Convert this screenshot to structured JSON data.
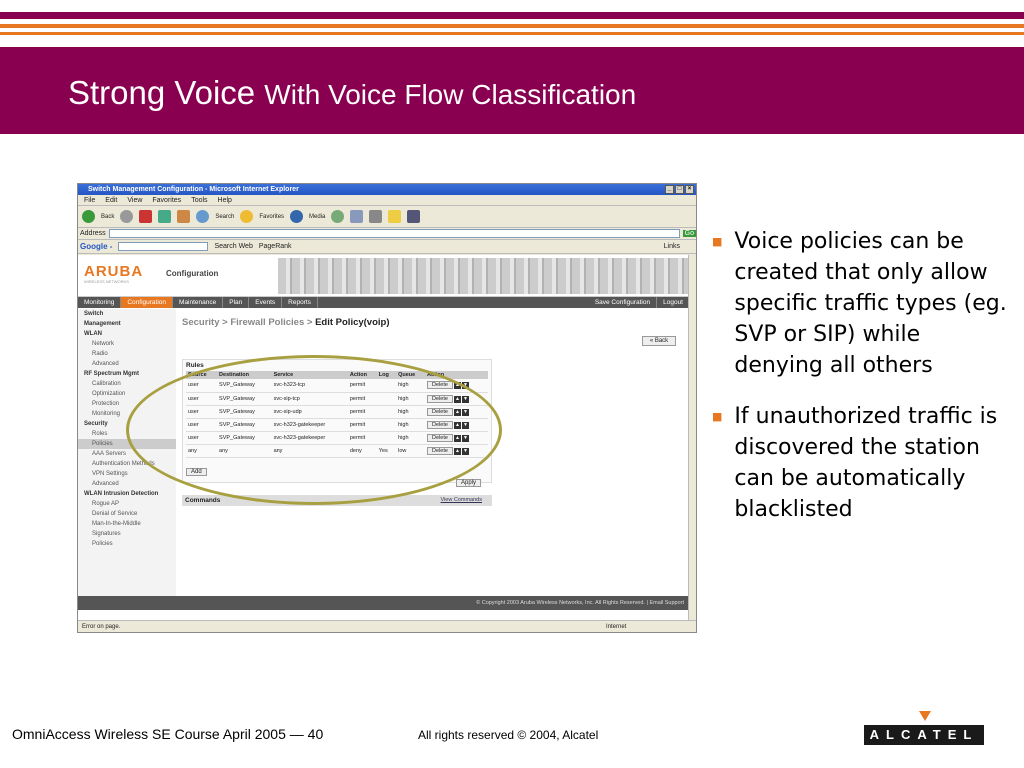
{
  "slide": {
    "title_large": "Strong Voice ",
    "title_small": "With Voice Flow Classification",
    "bullets": [
      "Voice policies can be created that only allow specific traffic types (eg. SVP or SIP) while denying all others",
      "If unauthorized traffic is discovered the station can be automatically blacklisted"
    ],
    "footer_course": "OmniAccess Wireless SE Course April 2005 — 40",
    "footer_rights": "All rights reserved © 2004, Alcatel",
    "logo_text": "ALCATEL"
  },
  "browser": {
    "window_title": "Switch Management Configuration - Microsoft Internet Explorer",
    "menu": [
      "File",
      "Edit",
      "View",
      "Favorites",
      "Tools",
      "Help"
    ],
    "toolbar": [
      "Back",
      "Search",
      "Favorites",
      "Media"
    ],
    "address_label": "Address",
    "go_label": "Go",
    "links_label": "Links",
    "google_label": "Google -",
    "search_web_label": "Search Web",
    "pagerank_label": "PageRank",
    "status_text": "Error on page.",
    "zone_text": "Internet"
  },
  "app": {
    "logo": "ARUBA",
    "logo_sub": "WIRELESS NETWORKS",
    "section": "Configuration",
    "nav": [
      "Monitoring",
      "Configuration",
      "Maintenance",
      "Plan",
      "Events",
      "Reports"
    ],
    "nav_right": [
      "Save Configuration",
      "Logout"
    ],
    "sidebar": [
      {
        "label": "Switch",
        "type": "hd"
      },
      {
        "label": "Management",
        "type": "hd"
      },
      {
        "label": "WLAN",
        "type": "hd"
      },
      {
        "label": "Network",
        "type": "sub"
      },
      {
        "label": "Radio",
        "type": "sub"
      },
      {
        "label": "Advanced",
        "type": "sub"
      },
      {
        "label": "RF Spectrum Mgmt",
        "type": "hd"
      },
      {
        "label": "Calibration",
        "type": "sub"
      },
      {
        "label": "Optimization",
        "type": "sub"
      },
      {
        "label": "Protection",
        "type": "sub"
      },
      {
        "label": "Monitoring",
        "type": "sub"
      },
      {
        "label": "Security",
        "type": "hd"
      },
      {
        "label": "Roles",
        "type": "sub"
      },
      {
        "label": "Policies",
        "type": "sub sel"
      },
      {
        "label": "AAA Servers",
        "type": "sub"
      },
      {
        "label": "Authentication Methods",
        "type": "sub"
      },
      {
        "label": "VPN Settings",
        "type": "sub"
      },
      {
        "label": "Advanced",
        "type": "sub"
      },
      {
        "label": "WLAN Intrusion Detection",
        "type": "hd"
      },
      {
        "label": "Rogue AP",
        "type": "sub"
      },
      {
        "label": "Denial of Service",
        "type": "sub"
      },
      {
        "label": "Man-In-the-Middle",
        "type": "sub"
      },
      {
        "label": "Signatures",
        "type": "sub"
      },
      {
        "label": "Policies",
        "type": "sub"
      }
    ],
    "breadcrumb": "Security > Firewall Policies > ",
    "breadcrumb_current": "Edit Policy(voip)",
    "back_label": "« Back",
    "rules_title": "Rules",
    "columns": [
      "Source",
      "Destination",
      "Service",
      "Action",
      "Log",
      "Queue",
      "Action"
    ],
    "rows": [
      [
        "user",
        "SVP_Gateway",
        "svc-h323-tcp",
        "permit",
        "",
        "high"
      ],
      [
        "user",
        "SVP_Gateway",
        "svc-sip-tcp",
        "permit",
        "",
        "high"
      ],
      [
        "user",
        "SVP_Gateway",
        "svc-sip-udp",
        "permit",
        "",
        "high"
      ],
      [
        "user",
        "SVP_Gateway",
        "svc-h323-gatekeeper",
        "permit",
        "",
        "high"
      ],
      [
        "user",
        "SVP_Gateway",
        "svc-h323-gatekeeper",
        "permit",
        "",
        "high"
      ],
      [
        "any",
        "any",
        "any",
        "deny",
        "Yes",
        "low"
      ]
    ],
    "delete_label": "Delete",
    "add_label": "Add",
    "apply_label": "Apply",
    "commands_label": "Commands",
    "view_commands_label": "View Commands",
    "copyright": "© Copyright 2003 Aruba Wireless Networks, Inc. All Rights Reserved. | Email Support"
  }
}
